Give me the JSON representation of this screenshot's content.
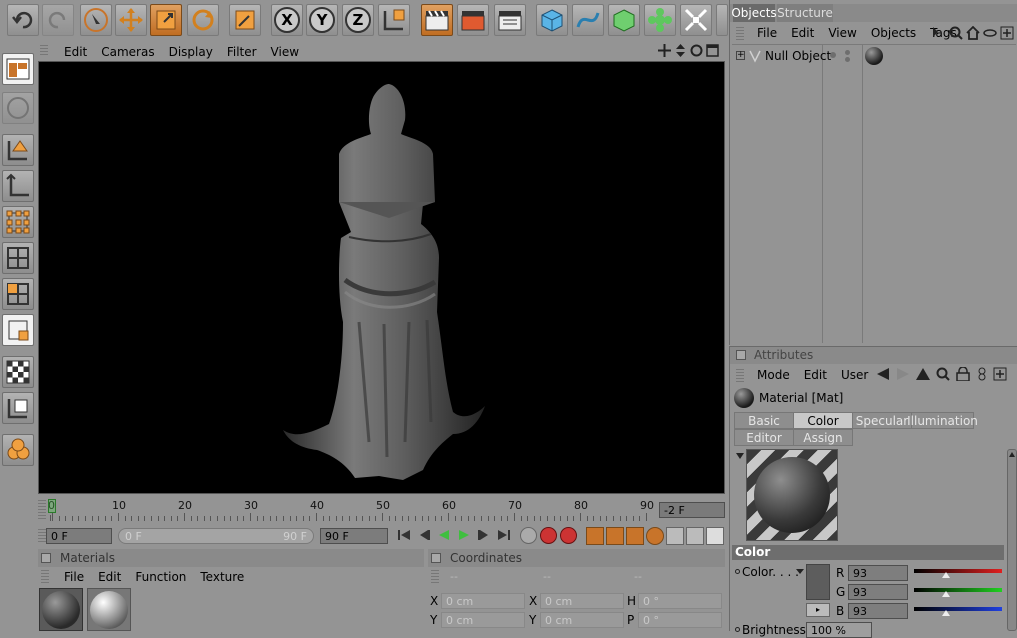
{
  "toolbar": {
    "buttons": [
      "undo-icon",
      "redo-icon",
      "live-select-icon",
      "move-icon",
      "scale-icon",
      "rotate-icon",
      "object-mode-icon",
      "x-axis-icon",
      "y-axis-icon",
      "z-axis-icon",
      "coordinate-system-icon",
      "render-view-icon",
      "render-picture-viewer-icon",
      "render-settings-icon",
      "cube-icon",
      "spline-icon",
      "nurbs-icon",
      "deformer-icon",
      "scene-icon"
    ],
    "axis_x": "X",
    "axis_y": "Y",
    "axis_z": "Z"
  },
  "viewport": {
    "menu": [
      "Edit",
      "Cameras",
      "Display",
      "Filter",
      "View"
    ]
  },
  "timeline": {
    "ticks": [
      "0",
      "10",
      "20",
      "30",
      "40",
      "50",
      "60",
      "70",
      "80",
      "90"
    ],
    "current_frame_field": "-2 F",
    "start_field": "0 F",
    "range_left": "0 F",
    "range_right": "90 F",
    "end_field": "90 F"
  },
  "materials": {
    "title": "Materials",
    "menu": [
      "File",
      "Edit",
      "Function",
      "Texture"
    ]
  },
  "coordinates": {
    "title": "Coordinates",
    "headers": [
      "--",
      "--",
      "--"
    ],
    "rows": [
      {
        "a": "X",
        "av": "0 cm",
        "b": "X",
        "bv": "0 cm",
        "c": "H",
        "cv": "0 °"
      },
      {
        "a": "Y",
        "av": "0 cm",
        "b": "Y",
        "bv": "0 cm",
        "c": "P",
        "cv": "0 °"
      }
    ]
  },
  "objects": {
    "tabs": [
      "Objects",
      "Structure"
    ],
    "menu": [
      "File",
      "Edit",
      "View",
      "Objects",
      "Tags"
    ],
    "items": [
      {
        "name": "Null Object"
      }
    ]
  },
  "attributes": {
    "title": "Attributes",
    "menu": [
      "Mode",
      "Edit",
      "User"
    ],
    "material_name": "Material [Mat]",
    "tabs_row1": [
      "Basic",
      "Color",
      "Specular",
      "Illumination"
    ],
    "tabs_row2": [
      "Editor",
      "Assign"
    ],
    "section": "Color",
    "color_label": "Color. . . .",
    "r_label": "R",
    "r_value": "93",
    "g_label": "G",
    "g_value": "93",
    "b_label": "B",
    "b_value": "93",
    "brightness_label": "Brightness",
    "brightness_value": "100 %"
  },
  "colors": {
    "accent_orange": "#c8742a",
    "viewport_bg": "#000000",
    "ui_bg": "#949494"
  }
}
